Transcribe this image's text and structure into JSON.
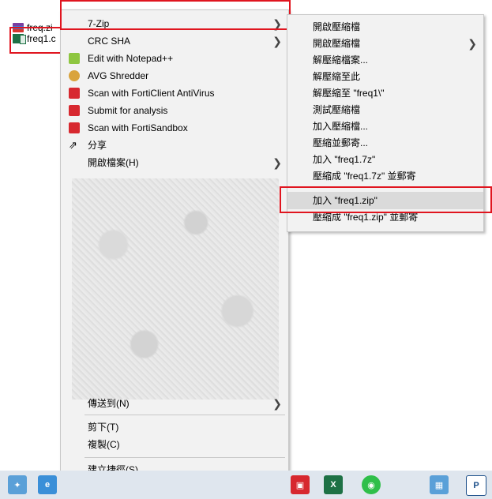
{
  "desktop": {
    "files": [
      {
        "name": "freq.zi",
        "icon": "winrar-archive-icon"
      },
      {
        "name": "freq1.c",
        "icon": "excel-file-icon"
      }
    ]
  },
  "context_menu": {
    "items": [
      {
        "label": "7-Zip",
        "has_submenu": true
      },
      {
        "label": "CRC SHA",
        "has_submenu": true
      },
      {
        "label": "Edit with Notepad++",
        "icon": "notepad-plus-plus-icon"
      },
      {
        "label": "AVG Shredder",
        "icon": "avg-shredder-icon"
      },
      {
        "label": "Scan with FortiClient AntiVirus",
        "icon": "forticlient-icon"
      },
      {
        "label": "Submit for analysis",
        "icon": "forticlient-icon"
      },
      {
        "label": "Scan with FortiSandbox",
        "icon": "forticlient-icon"
      },
      {
        "label": "分享",
        "icon": "share-icon"
      },
      {
        "label": "開啟檔案(H)",
        "has_submenu": true
      },
      {
        "label": "傳送到(N)",
        "has_submenu": true
      },
      {
        "label": "剪下(T)"
      },
      {
        "label": "複製(C)"
      },
      {
        "label": "建立捷徑(S)"
      }
    ]
  },
  "submenu": {
    "items": [
      {
        "label": "開啟壓縮檔"
      },
      {
        "label": "開啟壓縮檔",
        "has_submenu": true
      },
      {
        "label": "解壓縮檔案..."
      },
      {
        "label": "解壓縮至此"
      },
      {
        "label": "解壓縮至 \"freq1\\\""
      },
      {
        "label": "測試壓縮檔"
      },
      {
        "label": "加入壓縮檔..."
      },
      {
        "label": "壓縮並郵寄..."
      },
      {
        "label": "加入 \"freq1.7z\""
      },
      {
        "label": "壓縮成 \"freq1.7z\" 並郵寄"
      },
      {
        "label": "加入 \"freq1.zip\"",
        "highlighted": true
      },
      {
        "label": "壓縮成 \"freq1.zip\" 並郵寄"
      }
    ]
  },
  "colors": {
    "highlight_box": "#e0151f",
    "menu_bg": "#f2f2f2",
    "hover_bg": "#dadada"
  }
}
